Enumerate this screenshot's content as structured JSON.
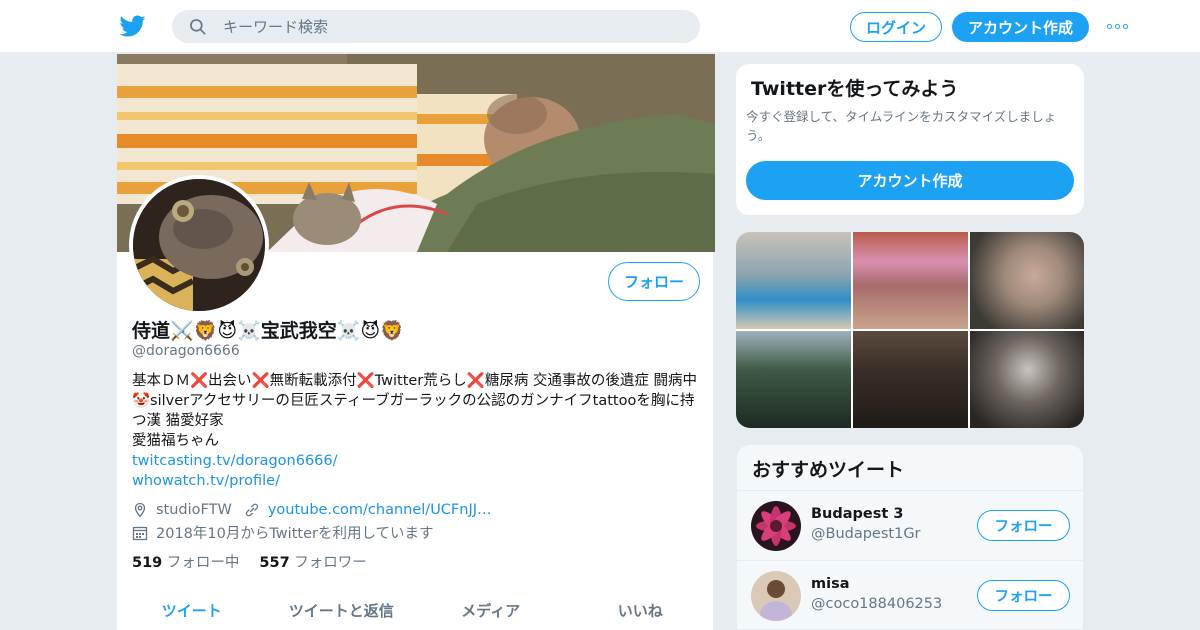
{
  "nav": {
    "search_placeholder": "キーワード検索",
    "login_label": "ログイン",
    "signup_label": "アカウント作成",
    "logo_icon": "twitter-bird-icon",
    "more_icon": "more-dots-icon",
    "accent": "#1da1f2"
  },
  "profile": {
    "display_name": "侍道⚔️🦁😈☠️宝武我空☠️😈🦁",
    "handle": "@doragon6666",
    "follow_label": "フォロー",
    "bio_lines": [
      "基本ＤＭ❌出会い❌無断転載添付❌Twitter荒らし❌糖尿病 交通事故の後遺症 闘病中🤡silverアクセサリーの巨匠スティーブガーラックの公認のガンナイフtattooを胸に持つ漢 猫愛好家",
      "愛猫福ちゃん"
    ],
    "links": [
      "twitcasting.tv/doragon6666/",
      "whowatch.tv/profile/"
    ],
    "location": "studioFTW",
    "website": "youtube.com/channel/UCFnJJ…",
    "joined": "2018年10月からTwitterを利用しています",
    "following_count": "519",
    "following_label": "フォロー中",
    "followers_count": "557",
    "followers_label": "フォロワー",
    "tabs": [
      "ツイート",
      "ツイートと返信",
      "メディア",
      "いいね"
    ]
  },
  "signup_card": {
    "title": "Twitterを使ってみよう",
    "desc": "今すぐ登録して、タイムラインをカスタマイズしましょう。",
    "button": "アカウント作成"
  },
  "recommended": {
    "title": "おすすめツイート",
    "users": [
      {
        "name": "Budapest 3",
        "handle": "@Budapest1Gr",
        "button": "フォロー"
      },
      {
        "name": "misa",
        "handle": "@coco188406253",
        "button": "フォロー"
      }
    ]
  }
}
